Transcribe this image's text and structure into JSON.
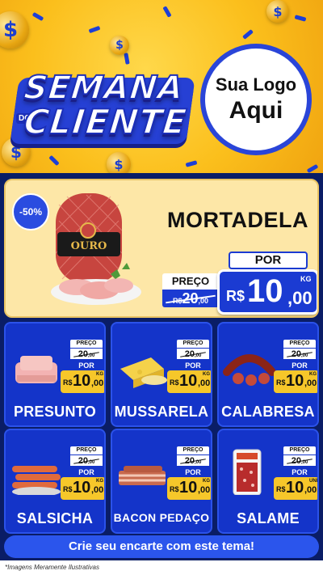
{
  "header": {
    "title_line1": "SEMANA",
    "title_do": "DO",
    "title_line2": "CLIENTE",
    "logo_line1": "Sua Logo",
    "logo_line2": "Aqui",
    "coin_symbol": "$"
  },
  "featured": {
    "discount": "-50%",
    "name": "MORTADELA",
    "brand_label": "OURO",
    "old_label": "PREÇO",
    "old_currency": "R$",
    "old_int": "20",
    "old_dec": ",00",
    "por_label": "POR",
    "currency": "R$",
    "price_int": "10",
    "price_dec": ",00",
    "unit": "KG"
  },
  "products": [
    {
      "name": "PRESUNTO",
      "old_label": "PREÇO",
      "old_int": "20",
      "old_dec": ",00",
      "por": "POR",
      "currency": "R$",
      "price_int": "10",
      "price_dec": ",00",
      "unit": "KG"
    },
    {
      "name": "MUSSARELA",
      "old_label": "PREÇO",
      "old_int": "20",
      "old_dec": ",00",
      "por": "POR",
      "currency": "R$",
      "price_int": "10",
      "price_dec": ",00",
      "unit": "KG"
    },
    {
      "name": "CALABRESA",
      "old_label": "PREÇO",
      "old_int": "20",
      "old_dec": ",00",
      "por": "POR",
      "currency": "R$",
      "price_int": "10",
      "price_dec": ",00",
      "unit": "KG"
    },
    {
      "name": "SALSICHA",
      "old_label": "PREÇO",
      "old_int": "20",
      "old_dec": ",00",
      "por": "POR",
      "currency": "R$",
      "price_int": "10",
      "price_dec": ",00",
      "unit": "KG"
    },
    {
      "name": "BACON PEDAÇO",
      "old_label": "PREÇO",
      "old_int": "20",
      "old_dec": ",00",
      "por": "POR",
      "currency": "R$",
      "price_int": "10",
      "price_dec": ",00",
      "unit": "KG"
    },
    {
      "name": "SALAME",
      "old_label": "PREÇO",
      "old_int": "20",
      "old_dec": ",00",
      "por": "POR",
      "currency": "R$",
      "price_int": "10",
      "price_dec": ",00",
      "unit": "UNID"
    }
  ],
  "cta": "Crie seu encarte com este tema!",
  "footnote": "*Imagens Meramente Ilustrativas",
  "colors": {
    "brand_blue": "#1434c9",
    "accent_yellow": "#f6c72a",
    "featured_bg": "#fde7a7"
  },
  "icons": [
    "coin-icon",
    "mortadela-image",
    "presunto-image",
    "mussarela-image",
    "calabresa-image",
    "salsicha-image",
    "bacon-image",
    "salame-image"
  ]
}
